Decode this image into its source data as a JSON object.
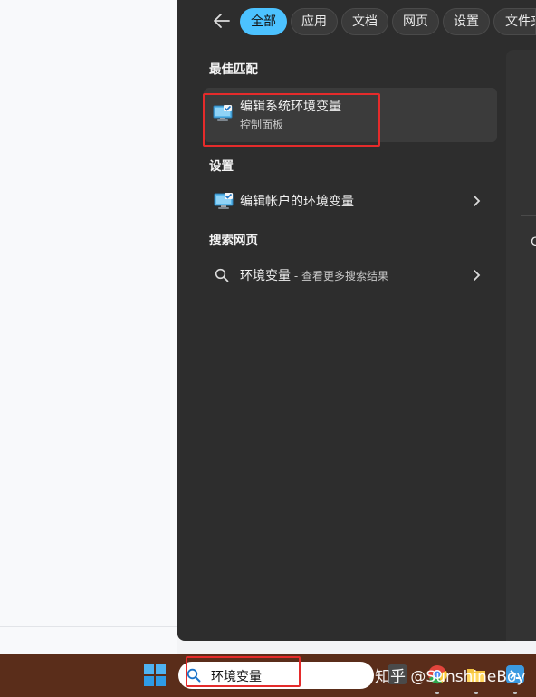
{
  "filters": {
    "back_label": "back",
    "tabs": [
      {
        "label": "全部",
        "active": true
      },
      {
        "label": "应用",
        "active": false
      },
      {
        "label": "文档",
        "active": false
      },
      {
        "label": "网页",
        "active": false
      },
      {
        "label": "设置",
        "active": false
      },
      {
        "label": "文件夹",
        "active": false
      }
    ]
  },
  "best_match": {
    "heading": "最佳匹配",
    "title": "编辑系统环境变量",
    "subtitle": "控制面板",
    "icon": "monitor-check-icon"
  },
  "settings": {
    "heading": "设置",
    "item": {
      "title": "编辑帐户的环境变量",
      "icon": "monitor-check-icon"
    }
  },
  "web": {
    "heading": "搜索网页",
    "item": {
      "query": "环境变量",
      "suffix": " - 查看更多搜索结果",
      "icon": "search-icon"
    }
  },
  "preview": {
    "glyph": "C"
  },
  "taskbar": {
    "search_value": "环境变量",
    "watermark": "知乎 @SunshineBoy"
  },
  "colors": {
    "accent": "#4cc2ff",
    "panel": "#2d2d2d",
    "highlight_box": "#e52b2b",
    "taskbar": "#5a2d1a"
  }
}
